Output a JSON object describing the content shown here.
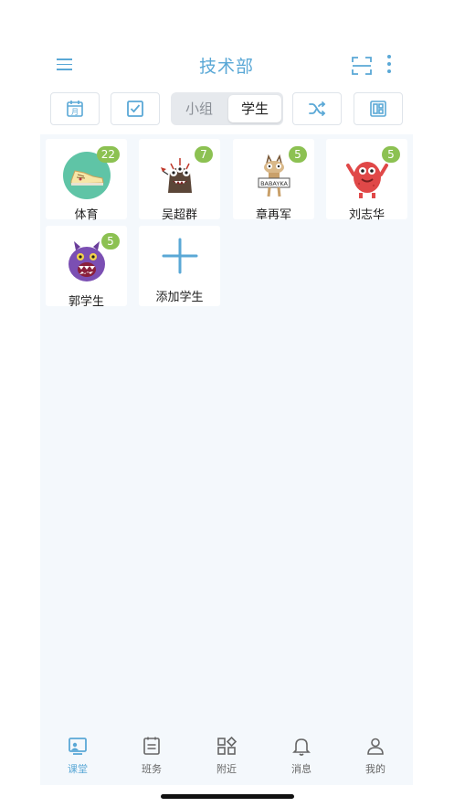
{
  "header": {
    "title": "技术部",
    "icons": [
      "menu-icon",
      "scan-icon",
      "more-vertical-icon"
    ]
  },
  "toolbar": {
    "buttons": [
      "calendar-month-icon",
      "checkbox-icon",
      "shuffle-icon",
      "layout-icon"
    ],
    "calendar_label": "月",
    "segment": {
      "options": [
        "小组",
        "学生"
      ],
      "selected": "学生"
    }
  },
  "students": [
    {
      "name": "体育",
      "points": "22",
      "avatar": "sneaker-avatar"
    },
    {
      "name": "吴超群",
      "points": "7",
      "avatar": "dark-monster-avatar"
    },
    {
      "name": "章再军",
      "points": "5",
      "avatar": "babayka-monster-avatar",
      "avatar_text": "BABAYKA"
    },
    {
      "name": "刘志华",
      "points": "5",
      "avatar": "red-monster-avatar"
    },
    {
      "name": "郭学生",
      "points": "5",
      "avatar": "purple-monster-avatar"
    }
  ],
  "add_student": {
    "label": "添加学生"
  },
  "tabs": [
    {
      "label": "课堂",
      "icon": "classroom-icon",
      "active": true
    },
    {
      "label": "班务",
      "icon": "clipboard-icon",
      "active": false
    },
    {
      "label": "附近",
      "icon": "apps-icon",
      "active": false
    },
    {
      "label": "消息",
      "icon": "bell-icon",
      "active": false
    },
    {
      "label": "我的",
      "icon": "user-icon",
      "active": false
    }
  ],
  "colors": {
    "accent": "#5aa8d6",
    "badge": "#8cc152",
    "content_bg": "#f4f8fc"
  }
}
